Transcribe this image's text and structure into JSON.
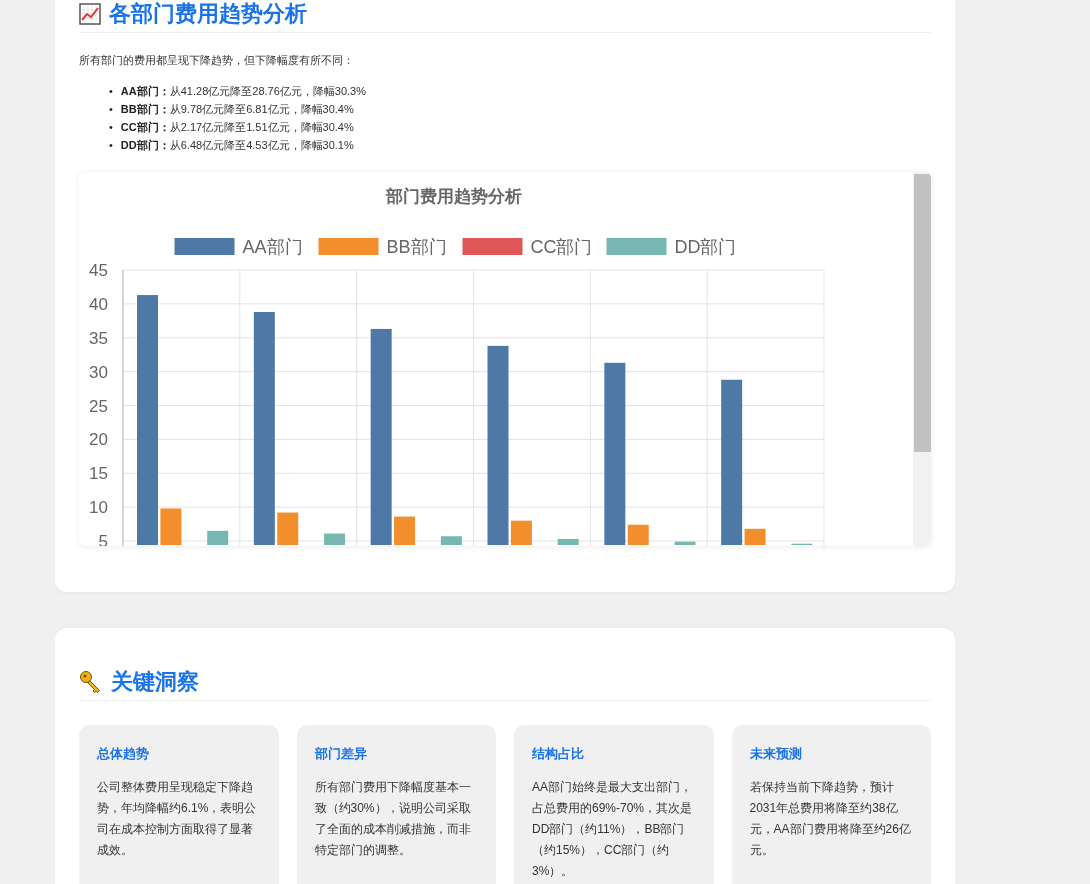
{
  "trend_section": {
    "title": "各部门费用趋势分析",
    "intro": "所有部门的费用都呈现下降趋势，但下降幅度有所不同：",
    "items": [
      {
        "marker": "•",
        "text": "**AA部门：**从41.28亿元降至28.76亿元，降幅30.3%"
      },
      {
        "marker": "•",
        "text": "**BB部门：**从9.78亿元降至6.81亿元，降幅30.4%"
      },
      {
        "marker": "•",
        "text": "**CC部门：**从2.17亿元降至1.51亿元，降幅30.4%"
      },
      {
        "marker": "•",
        "text": "**DD部门：**从6.48亿元降至4.53亿元，降幅30.1%"
      }
    ],
    "chart_data": {
      "type": "bar",
      "title": "部门费用趋势分析",
      "grid": true,
      "legend": "top",
      "ylim": [
        4.4,
        45
      ],
      "yticks": [
        5,
        10,
        15,
        20,
        25,
        30,
        35,
        40,
        45
      ],
      "series": [
        {
          "name": "AA部门",
          "color": "#4e79a7",
          "values": [
            41.3,
            38.8,
            36.3,
            33.8,
            31.3,
            28.8
          ]
        },
        {
          "name": "BB部门",
          "color": "#f28e2c",
          "values": [
            9.8,
            9.2,
            8.6,
            8.0,
            7.4,
            6.8
          ]
        },
        {
          "name": "CC部门",
          "color": "#e15759",
          "values": [
            null,
            null,
            null,
            null,
            null,
            null
          ]
        },
        {
          "name": "DD部门",
          "color": "#76b7b2",
          "values": [
            6.5,
            6.1,
            5.7,
            5.3,
            4.9,
            4.6
          ]
        }
      ]
    }
  },
  "insights_section": {
    "title": "关键洞察",
    "cards": [
      {
        "title": "总体趋势",
        "text": "公司整体费用呈现稳定下降趋势，年均降幅约6.1%，表明公司在成本控制方面取得了显著成效。"
      },
      {
        "title": "部门差异",
        "text": "所有部门费用下降幅度基本一致（约30%），说明公司采取了全面的成本削减措施，而非特定部门的调整。"
      },
      {
        "title": "结构占比",
        "text": "AA部门始终是最大支出部门，占总费用的69%-70%，其次是DD部门（约11%），BB部门（约15%），CC部门（约3%）。"
      },
      {
        "title": "未来预测",
        "text": "若保持当前下降趋势，预计2031年总费用将降至约38亿元，AA部门费用将降至约26亿元。"
      }
    ]
  }
}
